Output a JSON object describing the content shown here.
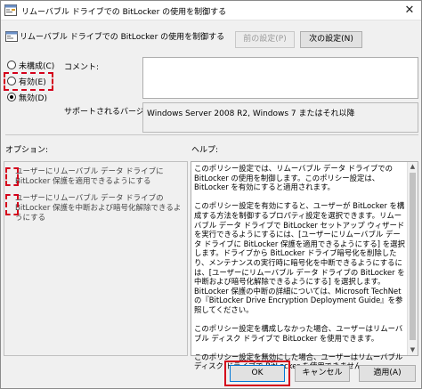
{
  "window": {
    "title": "リムーバブル ドライブでの BitLocker の使用を制御する",
    "close_glyph": "✕"
  },
  "header": {
    "policy_title": "リムーバブル ドライブでの BitLocker の使用を制御する",
    "prev_button": "前の設定(P)",
    "next_button": "次の設定(N)"
  },
  "state": {
    "not_configured": "未構成(C)",
    "enabled": "有効(E)",
    "disabled": "無効(D)",
    "selected": "disabled"
  },
  "comment": {
    "label": "コメント:",
    "value": ""
  },
  "supported": {
    "label": "サポートされるバージョン:",
    "value": "Windows Server 2008 R2, Windows 7 またはそれ以降"
  },
  "options": {
    "label": "オプション:",
    "items": [
      "ユーザーにリムーバブル データ ドライブに BitLocker 保護を適用できるようにする",
      "ユーザーにリムーバブル データ ドライブの BitLocker 保護を中断および暗号化解除できるようにする"
    ]
  },
  "help": {
    "label": "ヘルプ:",
    "paragraphs": [
      "このポリシー設定では、リムーバブル データ ドライブでの BitLocker の使用を制御します。このポリシー設定は、BitLocker を有効にすると適用されます。",
      "このポリシー設定を有効にすると、ユーザーが BitLocker を構成する方法を制御するプロパティ設定を選択できます。リムーバブル データ ドライブで BitLocker セットアップ ウィザードを実行できるようにするには、[ユーザーにリムーバブル データ ドライブに BitLocker 保護を適用できるようにする] を選択します。ドライブから BitLocker ドライブ暗号化を削除したり、メンテナンスの実行時に暗号化を中断できるようにするには、[ユーザーにリムーバブル データ ドライブの BitLocker を中断および暗号化解除できるようにする] を選択します。BitLocker 保護の中断の詳細については、Microsoft TechNet の『BitLocker Drive Encryption Deployment Guide』を参照してください。",
      "このポリシー設定を構成しなかった場合、ユーザーはリムーバブル ディスク ドライブで BitLocker を使用できます。",
      "このポリシー設定を無効にした場合、ユーザーはリムーバブル ディスク ドライブで BitLocker を使用できません。"
    ]
  },
  "footer": {
    "ok": "OK",
    "cancel": "キャンセル",
    "apply": "適用(A)"
  },
  "colors": {
    "highlight": "#d4001a",
    "accent": "#0078d7"
  },
  "icons": {
    "title": "policy-settings-icon",
    "header": "policy-settings-icon"
  }
}
